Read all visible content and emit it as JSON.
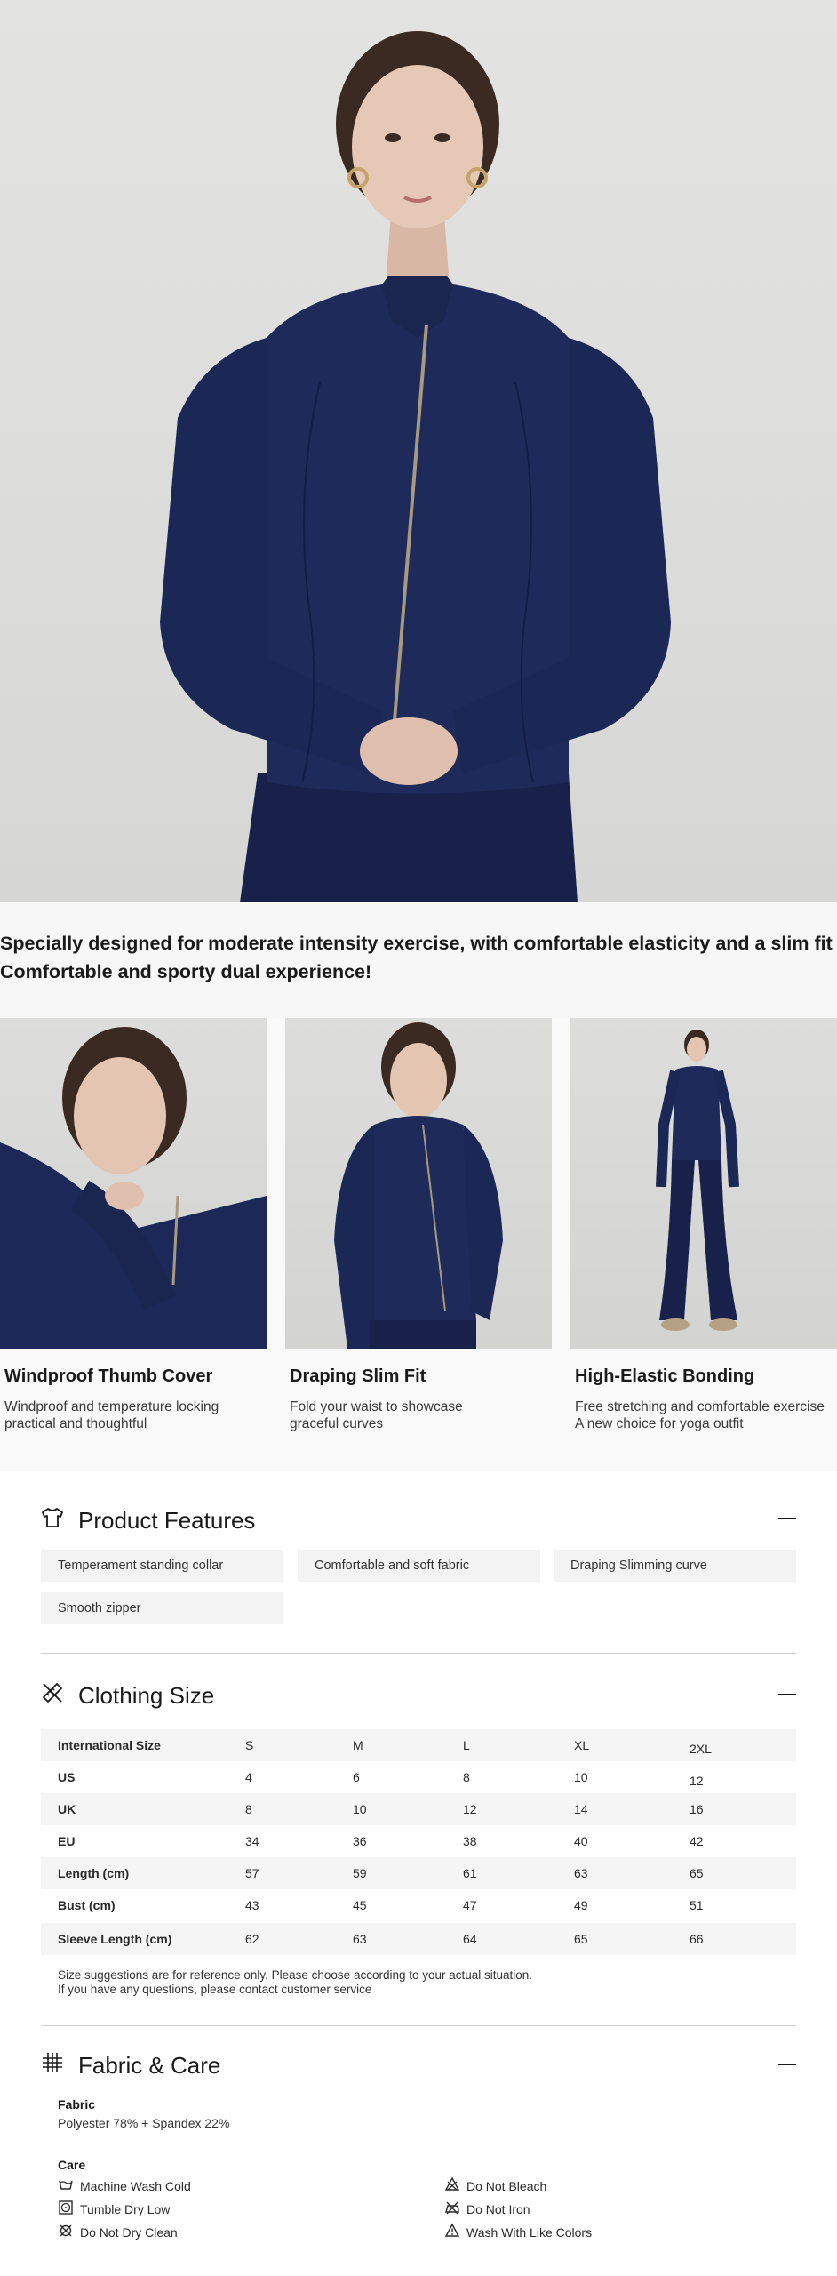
{
  "headline": {
    "line1": "Specially designed for moderate intensity exercise, with comfortable elasticity and a slim fit",
    "line2": "Comfortable and sporty dual experience!"
  },
  "cards": [
    {
      "title": "Windproof Thumb Cover",
      "desc1": "Windproof and temperature locking",
      "desc2": "practical and thoughtful"
    },
    {
      "title": "Draping Slim Fit",
      "desc1": "Fold your waist to showcase",
      "desc2": "graceful curves"
    },
    {
      "title": "High-Elastic Bonding",
      "desc1": "Free stretching and comfortable exercise",
      "desc2": "A new choice for yoga outfit"
    }
  ],
  "features": {
    "title": "Product Features",
    "chips": [
      "Temperament standing collar",
      "Comfortable and soft fabric",
      "Draping Slimming curve",
      "Smooth zipper"
    ]
  },
  "size": {
    "title": "Clothing Size",
    "header": [
      "International Size",
      "S",
      "M",
      "L",
      "XL",
      "2XL"
    ],
    "rows": [
      [
        "US",
        "4",
        "6",
        "8",
        "10",
        "12"
      ],
      [
        "UK",
        "8",
        "10",
        "12",
        "14",
        "16"
      ],
      [
        "EU",
        "34",
        "36",
        "38",
        "40",
        "42"
      ],
      [
        "Length (cm)",
        "57",
        "59",
        "61",
        "63",
        "65"
      ],
      [
        "Bust (cm)",
        "43",
        "45",
        "47",
        "49",
        "51"
      ],
      [
        "Sleeve Length (cm)",
        "62",
        "63",
        "64",
        "65",
        "66"
      ]
    ],
    "note1": "Size suggestions are for reference only. Please choose according to your actual situation.",
    "note2": "If you have any questions, please contact customer service"
  },
  "fabric": {
    "title": "Fabric & Care",
    "fabric_label": "Fabric",
    "fabric_value": "Polyester 78% + Spandex 22%",
    "care_label": "Care",
    "care_left": [
      {
        "icon": "washtub-icon",
        "label": "Machine Wash Cold"
      },
      {
        "icon": "tumble-dry-icon",
        "label": "Tumble Dry Low"
      },
      {
        "icon": "no-dry-clean-icon",
        "label": "Do Not Dry Clean"
      }
    ],
    "care_right": [
      {
        "icon": "no-bleach-icon",
        "label": "Do Not Bleach"
      },
      {
        "icon": "no-iron-icon",
        "label": "Do Not Iron"
      },
      {
        "icon": "warning-icon",
        "label": "Wash With Like Colors"
      }
    ]
  },
  "colors": {
    "navy": "#1d2a57",
    "chip_bg": "#f3f3f3",
    "row_alt": "#f5f5f5"
  }
}
